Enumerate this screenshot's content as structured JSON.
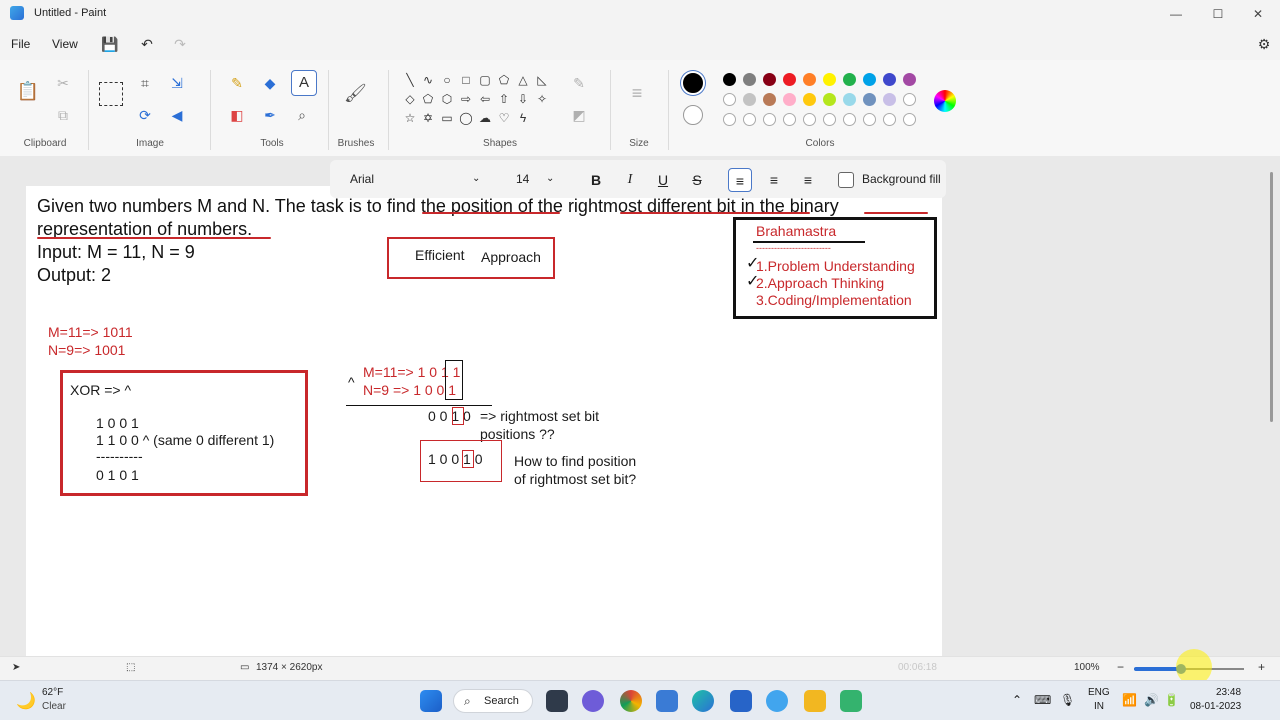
{
  "window": {
    "title": "Untitled - Paint",
    "controls": {
      "minimize": "—",
      "maximize": "☐",
      "close": "✕"
    }
  },
  "menu": {
    "file": "File",
    "view": "View"
  },
  "ribbon": {
    "groups": [
      "Clipboard",
      "Image",
      "Tools",
      "Brushes",
      "Shapes",
      "Size",
      "Colors"
    ],
    "colors_row1": [
      "#000000",
      "#7f7f7f",
      "#880015",
      "#ed1c24",
      "#ff7f27",
      "#fff200",
      "#22b14c",
      "#00a2e8",
      "#3f48cc",
      "#a349a4"
    ],
    "colors_row2": [
      "#ffffff",
      "#c3c3c3",
      "#b97a57",
      "#ffaec9",
      "#ffc90e",
      "#b5e61d",
      "#99d9ea",
      "#7092be",
      "#c8bfe7"
    ],
    "primary_color": "#000000",
    "secondary_color": "#ffffff"
  },
  "textbar": {
    "font": "Arial",
    "size": "14",
    "bold": "B",
    "italic": "I",
    "underline": "U",
    "strike": "S",
    "background_fill": "Background fill"
  },
  "canvas": {
    "problem_line1": "Given two numbers M and N. The task is to find the position of the rightmost different bit in the binary",
    "problem_line2": "representation of numbers.",
    "input": "Input: M = 11, N = 9",
    "output": "Output: 2",
    "efficient": "Efficient",
    "approach": "Approach",
    "brahamastra": "Brahamastra",
    "dashes": "-------------------------",
    "step1": "1.Problem  Understanding",
    "step2": "2.Approach Thinking",
    "step3": "3.Coding/Implementation",
    "m_bin": "M=11=> 1011",
    "n_bin": "N=9=>   1001",
    "xor_title": "XOR =>  ^",
    "xor_a": "1 0 0 1",
    "xor_b": "1 1  0 0  ^ (same 0 different 1)",
    "xor_line": "----------",
    "xor_res": "0 1 0 1",
    "caret": "^",
    "m_bits": "M=11=> 1 0 1 1",
    "n_bits": "N=9  =>  1 0 0 1",
    "res_bits": "0 0 1 0",
    "res_note1": "=> rightmost set bit",
    "res_note2": "positions ??",
    "bits_box": "1 0 0 1 0",
    "how1": "How to find position",
    "how2": "of rightmost set bit?"
  },
  "status": {
    "canvas_size": "1374 × 2620px",
    "time": "00:06:18",
    "zoom": "100%"
  },
  "taskbar": {
    "search": "Search",
    "weather_temp": "62°F",
    "weather_desc": "Clear",
    "lang1": "ENG",
    "lang2": "IN",
    "clock": "23:48",
    "date": "08-01-2023"
  }
}
